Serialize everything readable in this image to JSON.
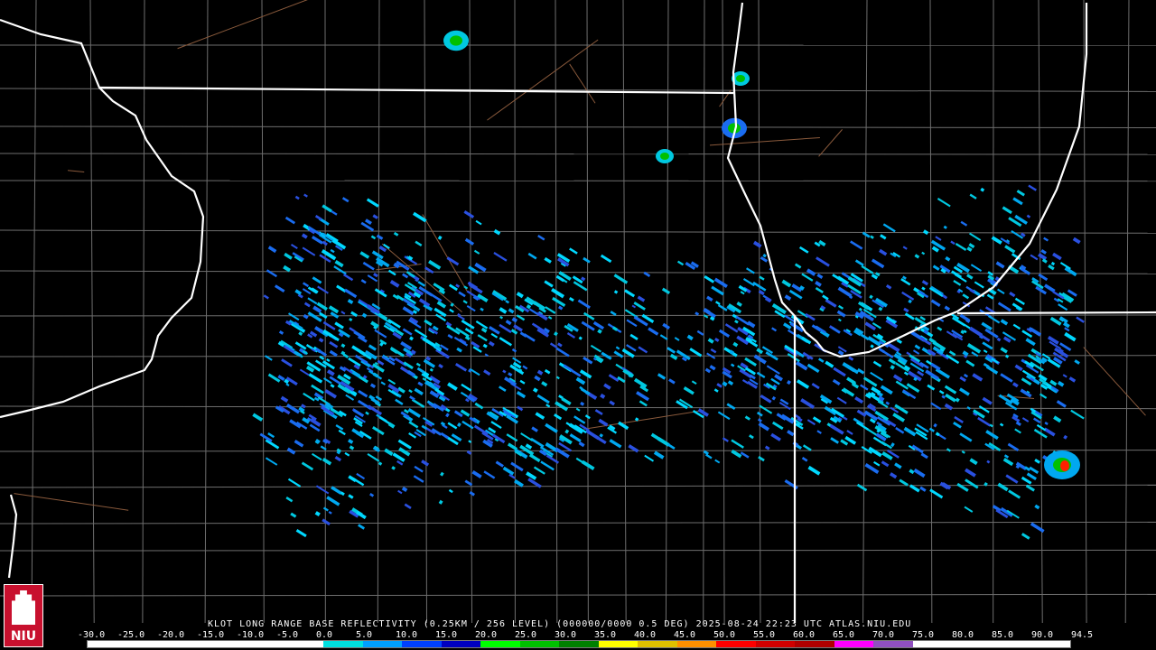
{
  "caption": "KLOT LONG RANGE BASE REFLECTIVITY (0.25KM / 256 LEVEL) (000000/0000 0.5 DEG) 2025-08-24 22:23 UTC  ATLAS.NIU.EDU",
  "scale_labels": [
    "-30.0",
    "-25.0",
    "-20.0",
    "-15.0",
    "-10.0",
    "-5.0",
    "0.0",
    "5.0",
    "10.0",
    "15.0",
    "20.0",
    "25.0",
    "30.0",
    "35.0",
    "40.0",
    "45.0",
    "50.0",
    "55.0",
    "60.0",
    "65.0",
    "70.0",
    "75.0",
    "80.0",
    "85.0",
    "90.0",
    "94.5"
  ],
  "colorbar_colors": [
    "#ffffff",
    "#ffffff",
    "#ffffff",
    "#ffffff",
    "#ffffff",
    "#ffffff",
    "#00e0e0",
    "#00a0ff",
    "#0040ff",
    "#0000c0",
    "#00ff00",
    "#00c000",
    "#008000",
    "#ffff00",
    "#e0c000",
    "#ff9000",
    "#ff0000",
    "#d00000",
    "#b00000",
    "#ff00ff",
    "#9050c0",
    "#ffffff",
    "#ffffff",
    "#ffffff",
    "#ffffff"
  ],
  "logo_text": "NIU",
  "map_colors": {
    "state_border": "#ffffff",
    "county_line": "#6e6e6e",
    "highway": "#8a5a3c"
  }
}
